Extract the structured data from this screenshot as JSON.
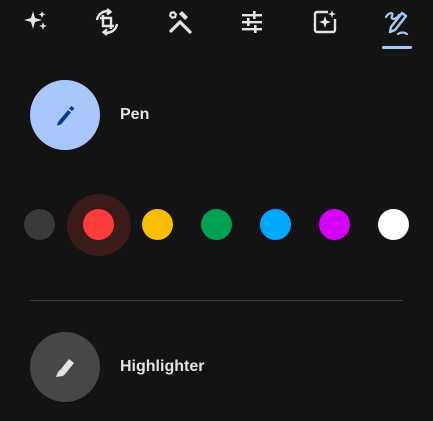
{
  "toolbar": {
    "tools": [
      {
        "icon": "sparkle-icon",
        "name": "magic"
      },
      {
        "icon": "crop-rotate-icon",
        "name": "crop"
      },
      {
        "icon": "tools-icon",
        "name": "tools"
      },
      {
        "icon": "sliders-icon",
        "name": "adjust"
      },
      {
        "icon": "filter-sparkle-icon",
        "name": "filters"
      },
      {
        "icon": "markup-icon",
        "name": "markup"
      }
    ],
    "active_tool": "markup",
    "active_color": "#a8c7fa"
  },
  "pen": {
    "label": "Pen",
    "icon": "pen-icon",
    "selected": true,
    "circle_color": "#a8c7fa"
  },
  "colors": {
    "selected": "red",
    "swatches": [
      {
        "name": "dark-gray",
        "hex": "#3a3a3a"
      },
      {
        "name": "red",
        "hex": "#ff3b3b"
      },
      {
        "name": "yellow",
        "hex": "#fbbc04"
      },
      {
        "name": "green",
        "hex": "#00a152"
      },
      {
        "name": "blue",
        "hex": "#00a8ff"
      },
      {
        "name": "purple",
        "hex": "#d500f9"
      },
      {
        "name": "white",
        "hex": "#ffffff"
      }
    ]
  },
  "highlighter": {
    "label": "Highlighter",
    "icon": "highlighter-icon",
    "selected": false,
    "circle_color": "#474747"
  }
}
